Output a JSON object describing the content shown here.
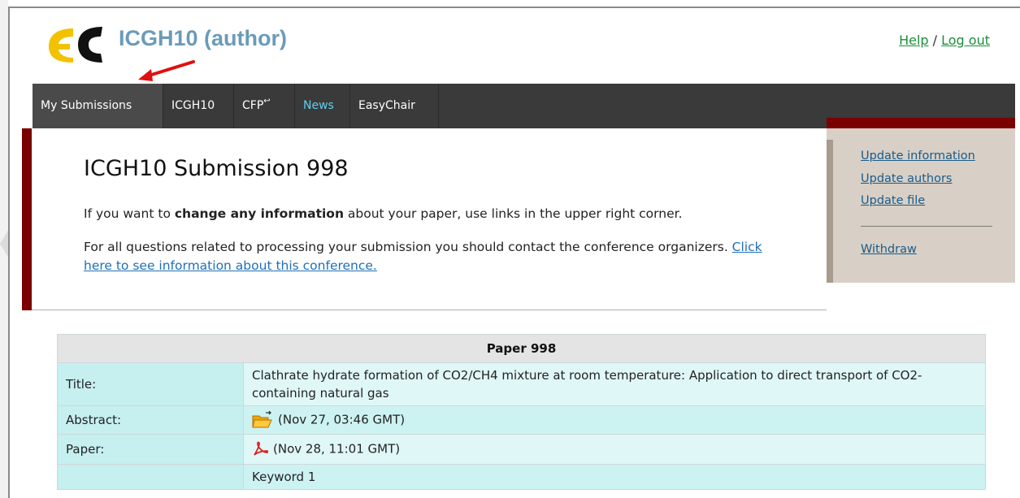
{
  "header": {
    "app_title": "ICGH10 (author)",
    "help_link": "Help",
    "separator": "/",
    "logout_link": "Log out"
  },
  "nav": {
    "items": [
      "My Submissions",
      "ICGH10",
      "CFP",
      "News",
      "EasyChair"
    ]
  },
  "main": {
    "title": "ICGH10 Submission 998",
    "para1_pre": "If you want to ",
    "para1_bold": "change any information",
    "para1_post": " about your paper, use links in the upper right corner.",
    "para2_text": "For all questions related to processing your submission you should contact the conference organizers. ",
    "para2_link": "Click here to see information about this conference."
  },
  "side_panel": {
    "links": [
      "Update information",
      "Update authors",
      "Update file"
    ],
    "withdraw": "Withdraw"
  },
  "paper_table": {
    "header": "Paper 998",
    "rows": [
      {
        "label": "Title:",
        "value": "Clathrate hydrate formation of CO2/CH4 mixture at room temperature: Application to direct transport of CO2-containing natural gas"
      },
      {
        "label": "Abstract:",
        "value": "(Nov 27, 03:46 GMT)",
        "icon": "folder-icon"
      },
      {
        "label": "Paper:",
        "value": "(Nov 28, 11:01 GMT)",
        "icon": "pdf-icon"
      },
      {
        "label": "",
        "value": "Keyword 1"
      }
    ]
  },
  "colors": {
    "accent_dark_red": "#7a0000",
    "nav_bg": "#3a3a3a",
    "title_blue": "#6b9bb8",
    "link_green": "#1b8f3a",
    "table_label_bg": "#c6efef"
  }
}
